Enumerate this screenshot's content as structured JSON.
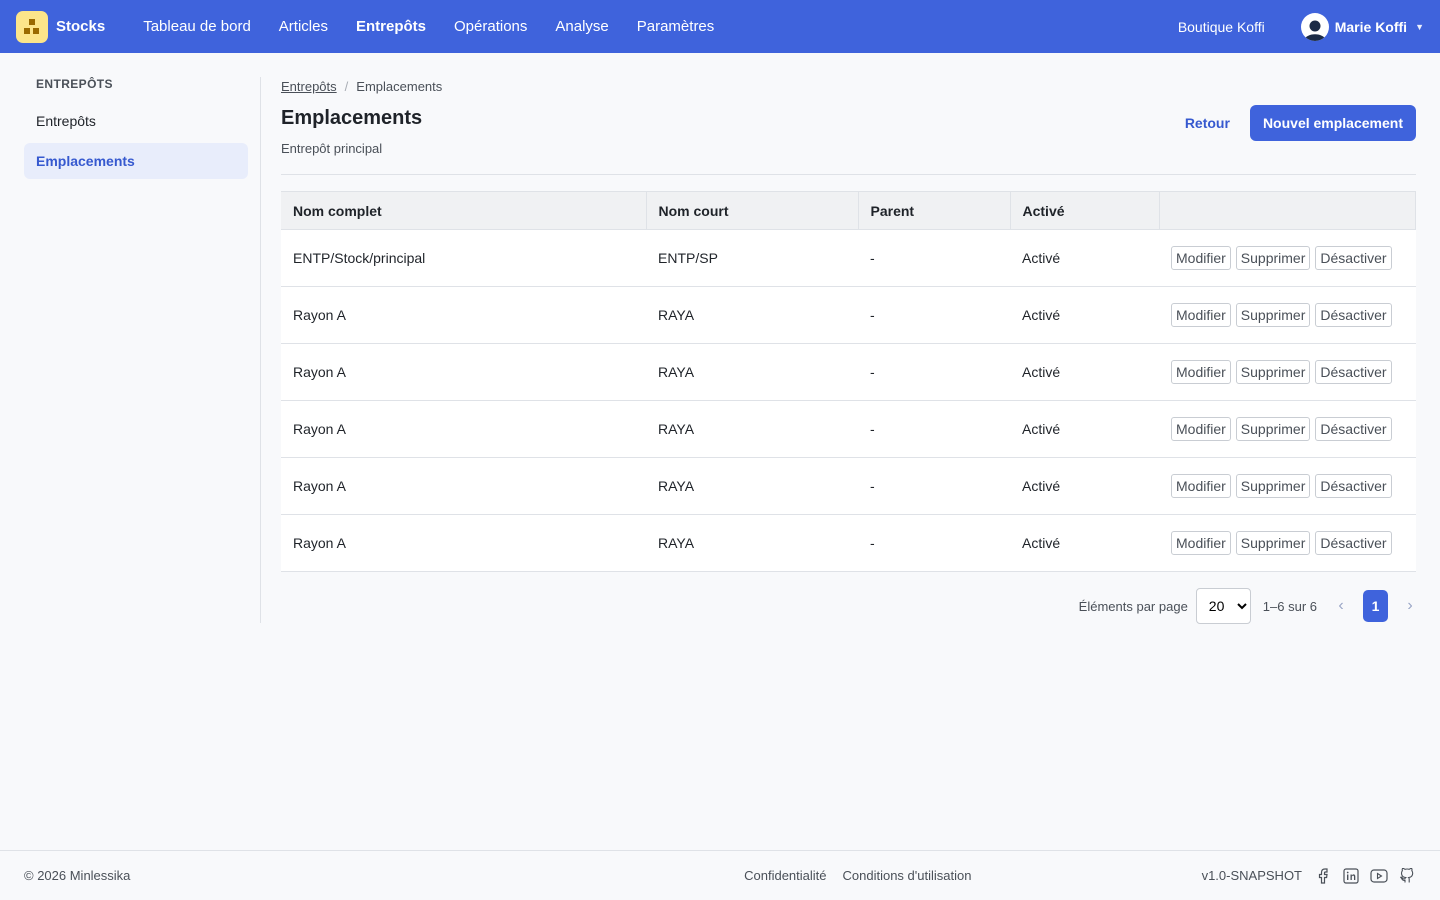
{
  "brand": {
    "name": "Stocks",
    "logo_icon": "boxes-icon"
  },
  "nav": {
    "items": [
      {
        "label": "Tableau de bord",
        "active": false
      },
      {
        "label": "Articles",
        "active": false
      },
      {
        "label": "Entrepôts",
        "active": true
      },
      {
        "label": "Opérations",
        "active": false
      },
      {
        "label": "Analyse",
        "active": false
      },
      {
        "label": "Paramètres",
        "active": false
      }
    ],
    "shop": "Boutique Koffi",
    "user": "Marie Koffi"
  },
  "sidebar": {
    "title": "ENTREPÔTS",
    "items": [
      {
        "label": "Entrepôts",
        "active": false
      },
      {
        "label": "Emplacements",
        "active": true
      }
    ]
  },
  "breadcrumb": {
    "parent": "Entrepôts",
    "separator": "/",
    "current": "Emplacements"
  },
  "page": {
    "title": "Emplacements",
    "subtitle": "Entrepôt principal",
    "back_label": "Retour",
    "new_label": "Nouvel emplacement"
  },
  "table": {
    "headers": [
      "Nom complet",
      "Nom court",
      "Parent",
      "Activé",
      ""
    ],
    "action_labels": {
      "edit": "Modifier",
      "delete": "Supprimer",
      "deactivate": "Désactiver"
    },
    "rows": [
      {
        "full_name": "ENTP/Stock/principal",
        "short_name": "ENTP/SP",
        "parent": "-",
        "active": "Activé"
      },
      {
        "full_name": "Rayon A",
        "short_name": "RAYA",
        "parent": "-",
        "active": "Activé"
      },
      {
        "full_name": "Rayon A",
        "short_name": "RAYA",
        "parent": "-",
        "active": "Activé"
      },
      {
        "full_name": "Rayon A",
        "short_name": "RAYA",
        "parent": "-",
        "active": "Activé"
      },
      {
        "full_name": "Rayon A",
        "short_name": "RAYA",
        "parent": "-",
        "active": "Activé"
      },
      {
        "full_name": "Rayon A",
        "short_name": "RAYA",
        "parent": "-",
        "active": "Activé"
      }
    ]
  },
  "pagination": {
    "per_page_label": "Éléments par page",
    "per_page_value": "20",
    "range": "1–6 sur 6",
    "current_page": "1",
    "prev": "‹",
    "next": "›"
  },
  "footer": {
    "copyright": "© 2026 Minlessika",
    "links": [
      "Confidentialité",
      "Conditions d'utilisation"
    ],
    "version": "v1.0-SNAPSHOT",
    "social_icons": [
      "facebook-icon",
      "linkedin-icon",
      "youtube-icon",
      "github-icon"
    ]
  },
  "colors": {
    "primary": "#3f63dc",
    "logo_bg": "#fce58a",
    "active_bg": "#e8edfb"
  }
}
